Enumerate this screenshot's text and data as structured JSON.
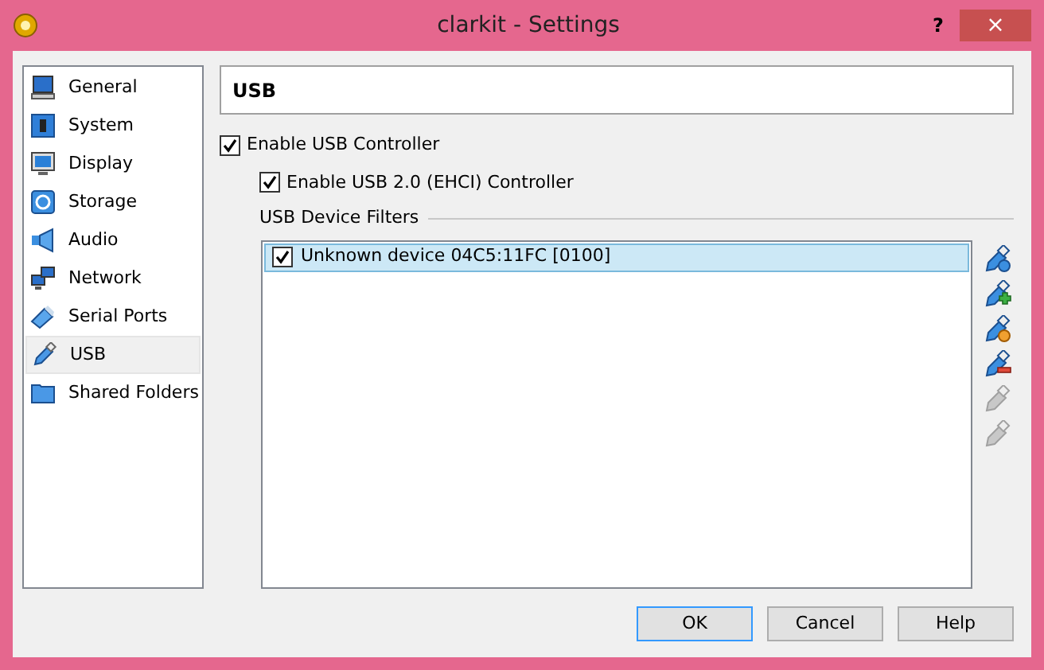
{
  "window": {
    "title": "clarkit - Settings",
    "help": "?",
    "close": "×"
  },
  "sidebar": {
    "items": [
      {
        "label": "General",
        "kind": "general",
        "selected": false
      },
      {
        "label": "System",
        "kind": "system",
        "selected": false
      },
      {
        "label": "Display",
        "kind": "display",
        "selected": false
      },
      {
        "label": "Storage",
        "kind": "storage",
        "selected": false
      },
      {
        "label": "Audio",
        "kind": "audio",
        "selected": false
      },
      {
        "label": "Network",
        "kind": "network",
        "selected": false
      },
      {
        "label": "Serial Ports",
        "kind": "serial",
        "selected": false
      },
      {
        "label": "USB",
        "kind": "usb",
        "selected": true
      },
      {
        "label": "Shared Folders",
        "kind": "folder",
        "selected": false
      }
    ]
  },
  "page": {
    "title": "USB",
    "enable_usb": {
      "label": "Enable USB Controller",
      "checked": true
    },
    "enable_ehci": {
      "label": "Enable USB 2.0 (EHCI) Controller",
      "checked": true
    },
    "filters_label": "USB Device Filters",
    "filters": [
      {
        "label": "Unknown device 04C5:11FC [0100]",
        "checked": true,
        "selected": true
      }
    ],
    "tools": [
      {
        "kind": "plain",
        "disabled": false
      },
      {
        "kind": "add",
        "disabled": false
      },
      {
        "kind": "edit",
        "disabled": false
      },
      {
        "kind": "remove",
        "disabled": false
      },
      {
        "kind": "up",
        "disabled": true
      },
      {
        "kind": "down",
        "disabled": true
      }
    ]
  },
  "buttons": [
    {
      "label": "OK",
      "default": true
    },
    {
      "label": "Cancel",
      "default": false
    },
    {
      "label": "Help",
      "default": false
    }
  ]
}
